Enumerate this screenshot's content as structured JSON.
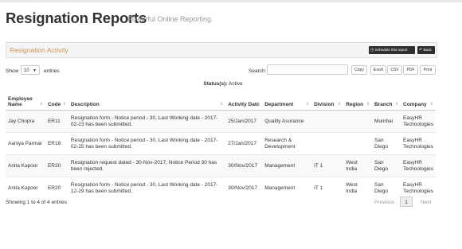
{
  "header": {
    "title": "Resignation Reports",
    "subtitle": "Powerful Online Reporting."
  },
  "panel": {
    "title": "Resignation Activity",
    "schedule_label": "Schedule this report",
    "back_label": "Back"
  },
  "controls": {
    "show_label": "Show",
    "length_value": "10",
    "entries_label": "entries",
    "search_label": "Search:",
    "search_value": "",
    "buttons": [
      "Copy",
      "Excel",
      "CSV",
      "PDF",
      "Print"
    ]
  },
  "status": {
    "label": "Status(s):",
    "value": "Active"
  },
  "table": {
    "columns": [
      "Employee Name",
      "Code",
      "Description",
      "Activity Date",
      "Department",
      "Division",
      "Region",
      "Branch",
      "Company"
    ],
    "rows": [
      [
        "Jay Chopra",
        "ER11",
        "Resignation form - Notice period - 30, Last Working date - 2017-02-23 has been submitted.",
        "25/Jan/2017",
        "Quality Asurance",
        "",
        "",
        "Mumbai",
        "EasyHR Technologies"
      ],
      [
        "Aaniya Parmar",
        "ER18",
        "Resignation form - Notice period - 30, Last Working date - 2017-02-25 has been submitted.",
        "27/Jan/2017",
        "Research & Development",
        "",
        "",
        "San Diego",
        "EasyHR Technologies"
      ],
      [
        "Anita Kapoor",
        "ER20",
        "Resignation request dated - 30-Nov-2017, Notice Period 30 has been rejected.",
        "30/Nov/2017",
        "Management",
        "IT 1",
        "West India",
        "San Diego",
        "EasyHR Technologies"
      ],
      [
        "Anita Kapoor",
        "ER20",
        "Resignation form - Notice period - 30, Last Working date - 2017-12-29 has been submitted.",
        "30/Nov/2017",
        "Management",
        "IT 1",
        "West India",
        "San Diego",
        "EasyHR Technologies"
      ]
    ]
  },
  "footer": {
    "info": "Showing 1 to 4 of 4 entries",
    "previous": "Previous",
    "page": "1",
    "next": "Next"
  }
}
